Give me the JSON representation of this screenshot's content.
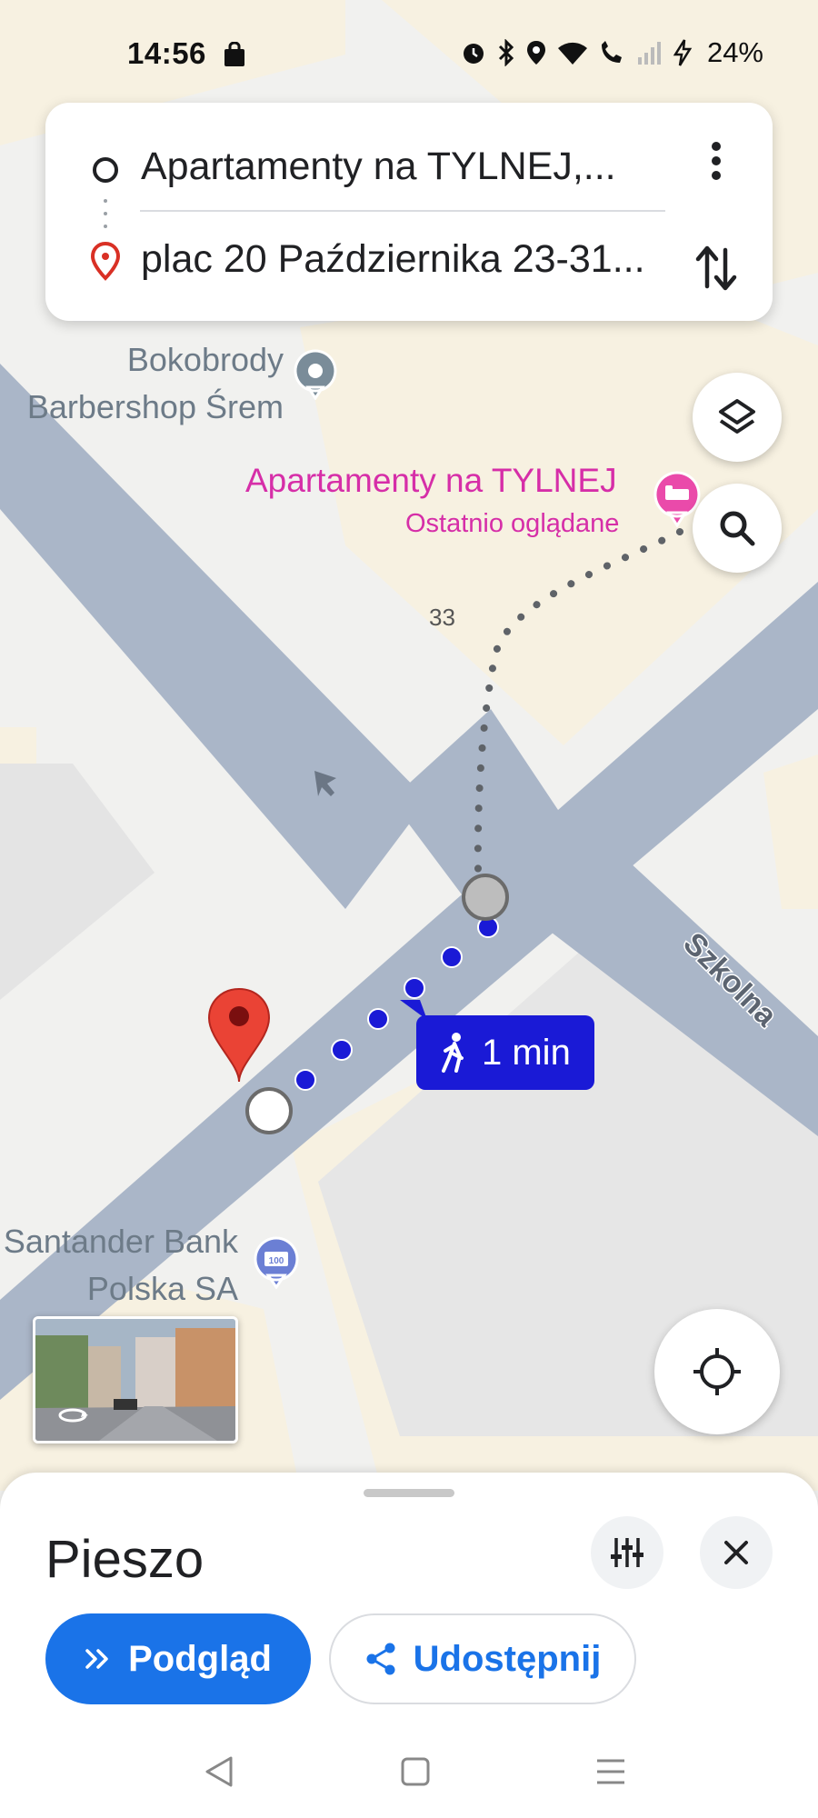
{
  "status_bar": {
    "time": "14:56",
    "battery": "24%",
    "icons": [
      "shopping-bag-icon",
      "alarm-icon",
      "bluetooth-icon",
      "location-icon",
      "wifi-icon",
      "wifi-call-icon",
      "signal-icon",
      "charging-icon"
    ]
  },
  "route_card": {
    "origin": "Apartamenty na TYLNEJ,...",
    "destination": "plac 20 Października 23-31..."
  },
  "map": {
    "street_number": "33",
    "street_name": "Szkolna",
    "pois": {
      "barbershop_line1": "Bokobrody",
      "barbershop_line2": "Barbershop Śrem",
      "hotel_name": "Apartamenty na TYLNEJ",
      "hotel_sub": "Ostatnio oglądane",
      "bank_line1": "Santander Bank",
      "bank_line2": "Polska SA"
    },
    "eta": "1 min",
    "colors": {
      "road": "#aab6c8",
      "block": "#f7f1e1",
      "route": "#1a1ad6",
      "poi_pink": "#d62ea8",
      "pin_red": "#ea4335"
    }
  },
  "sheet": {
    "title": "Pieszo",
    "preview_label": "Podgląd",
    "share_label": "Udostępnij"
  }
}
